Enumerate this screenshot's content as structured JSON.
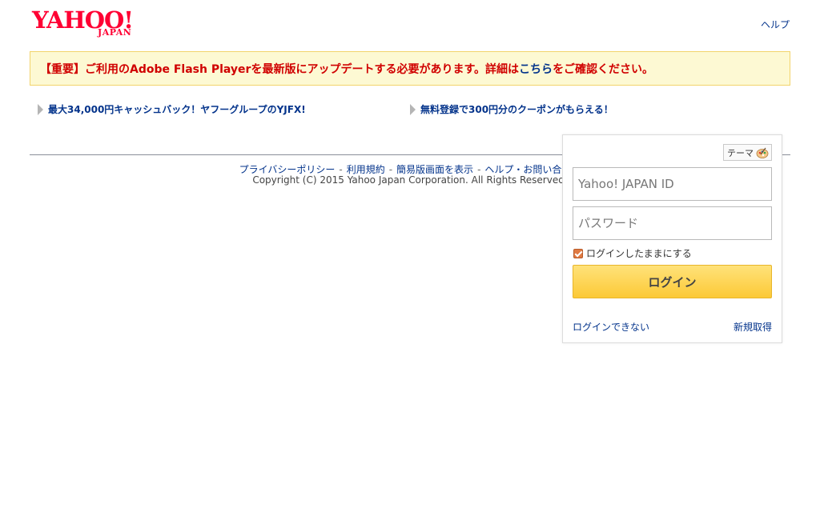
{
  "header": {
    "logo_main": "YAHOO!",
    "logo_sub": "JAPAN",
    "help_label": "ヘルプ"
  },
  "notice": {
    "text_before": "【重要】ご利用のAdobe Flash Playerを最新版にアップデートする必要があります。詳細は",
    "link_text": "こちら",
    "text_after": "をご確認ください。"
  },
  "promos": [
    {
      "label": "最大34,000円キャッシュバック！ヤフーグループのYJFX!"
    },
    {
      "label": "無料登録で300円分のクーポンがもらえる！"
    }
  ],
  "footer": {
    "links": [
      "プライバシーポリシー",
      "利用規約",
      "簡易版画面を表示",
      "ヘルプ・お問い合わせ"
    ],
    "separator": "-",
    "copyright": "Copyright (C) 2015 Yahoo Japan Corporation. All Rights Reserved."
  },
  "login": {
    "theme_label": "テーマ",
    "id_placeholder": "Yahoo! JAPAN ID",
    "password_placeholder": "パスワード",
    "remember_label": "ログインしたままにする",
    "remember_checked": true,
    "login_button": "ログイン",
    "cant_login": "ログインできない",
    "signup": "新規取得"
  },
  "colors": {
    "brand": "#ff0033",
    "link": "#03338b",
    "notice_text": "#d00000",
    "notice_bg": "#fdf9d3",
    "login_button": "#fcc936"
  }
}
